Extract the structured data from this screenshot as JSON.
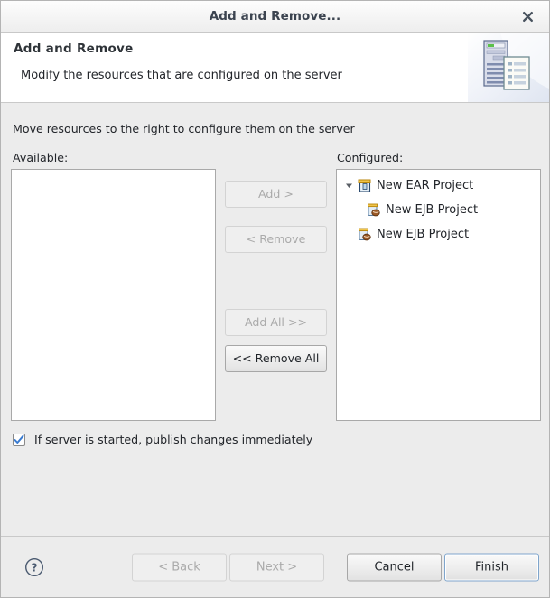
{
  "window": {
    "title": "Add and Remove...",
    "close_icon": "close-x-icon"
  },
  "header": {
    "title": "Add and Remove",
    "description": "Modify the resources that are configured on the server",
    "icon": "server-and-document-icon"
  },
  "main": {
    "instruction": "Move resources to the right to configure them on the server",
    "available_label": "Available:",
    "configured_label": "Configured:",
    "available_items": [],
    "configured_tree": [
      {
        "label": "New EAR Project",
        "icon": "ear-archive-icon",
        "expanded": true,
        "twisty": "triangle-down-icon",
        "level": 0,
        "children": [
          {
            "label": "New EJB Project",
            "icon": "ejb-jar-bean-icon",
            "level": 1,
            "children": []
          }
        ]
      },
      {
        "label": "New EJB Project",
        "icon": "ejb-jar-bean-icon",
        "level": 0,
        "children": []
      }
    ],
    "transfer_buttons": [
      {
        "label": "Add >",
        "enabled": false
      },
      {
        "label": "< Remove",
        "enabled": false
      },
      {
        "label": "Add All >>",
        "enabled": false
      },
      {
        "label": "<< Remove All",
        "enabled": true
      }
    ],
    "publish_checkbox": {
      "label": "If server is started, publish changes immediately",
      "checked": true
    }
  },
  "footer": {
    "help_icon": "help-question-icon",
    "buttons": [
      {
        "label": "< Back",
        "enabled": false,
        "focused": false
      },
      {
        "label": "Next >",
        "enabled": false,
        "focused": false
      },
      {
        "label": "Cancel",
        "enabled": true,
        "focused": false
      },
      {
        "label": "Finish",
        "enabled": true,
        "focused": true
      }
    ]
  },
  "colors": {
    "dialog_bg": "#ececec",
    "panel_bg": "#ffffff",
    "text": "#22252a",
    "disabled_text": "#aaaaaa",
    "checkbox_accent": "#3a7bd0",
    "focus_border": "#7fa5cc",
    "border": "#a9a9a9"
  }
}
